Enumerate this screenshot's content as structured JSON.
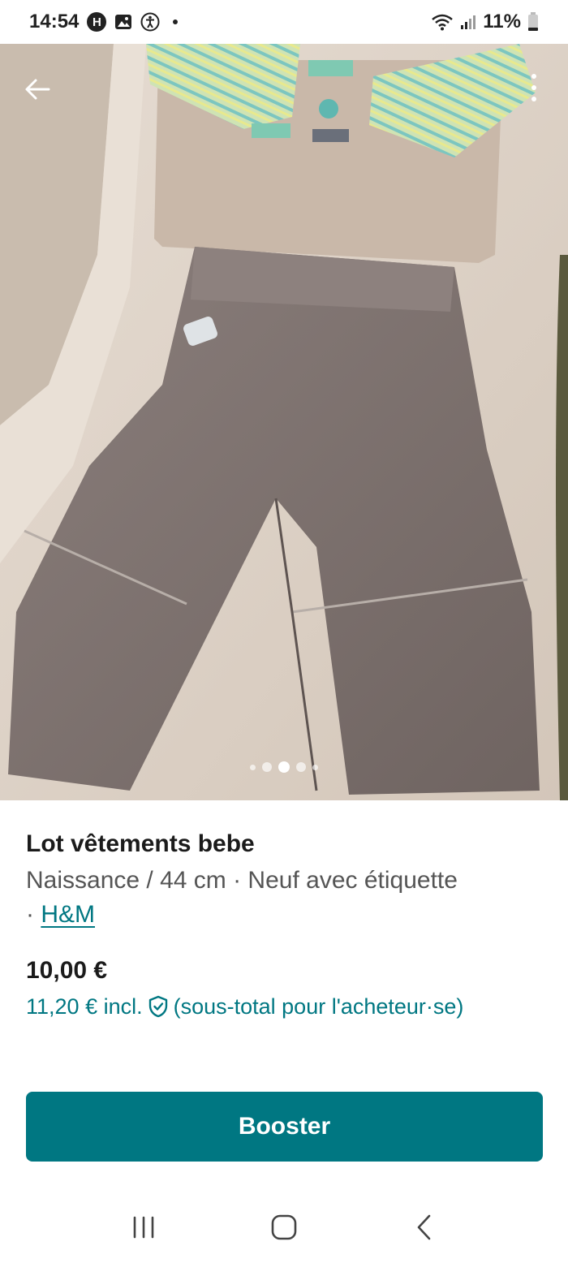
{
  "status_bar": {
    "time": "14:54",
    "icons": [
      "h-badge-icon",
      "image-icon",
      "accessibility-icon",
      "notification-dot"
    ],
    "right_icons": [
      "wifi-icon",
      "signal-icon",
      "battery-icon"
    ],
    "battery": "11%"
  },
  "listing": {
    "photo": {
      "description_icon": "clothing-photo",
      "page_count": 5,
      "active_index": 2
    },
    "title": "Lot vêtements bebe",
    "subtitle_prefix": "Naissance / 44 cm · Neuf avec étiquette",
    "brand_separator": "·",
    "brand": "H&M",
    "price": "10,00 €",
    "price_incl_prefix": "11,20 € incl.",
    "price_incl_suffix": "(sous-total pour l'acheteur·se)",
    "protection_icon": "shield-check-icon"
  },
  "actions": {
    "booster_label": "Booster"
  },
  "nav": {
    "recents": "recents-icon",
    "home": "home-icon",
    "back": "back-icon"
  },
  "colors": {
    "accent": "#007782",
    "text": "#1b1b1b",
    "muted": "#555555"
  }
}
